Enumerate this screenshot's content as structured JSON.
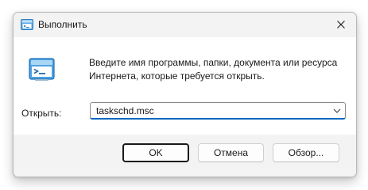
{
  "window": {
    "title": "Выполнить",
    "title_icon": "run-app-icon",
    "close_icon": "close-icon"
  },
  "main": {
    "icon": "run-app-icon",
    "description_line1": "Введите имя программы, папки, документа или ресурса",
    "description_line2": "Интернета, которые требуется открыть.",
    "open_label": "Открыть:",
    "open_value": "taskschd.msc",
    "dropdown_icon": "chevron-down-icon"
  },
  "buttons": {
    "ok": "OK",
    "cancel": "Отмена",
    "browse": "Обзор..."
  },
  "colors": {
    "accent": "#0067c0",
    "window_bg": "#f3f3f3",
    "content_bg": "#ffffff"
  }
}
